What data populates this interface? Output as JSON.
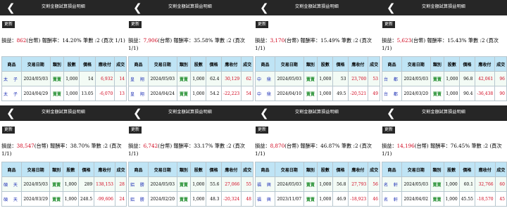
{
  "header": {
    "title": "交割金額試算損益明細",
    "back_icon": "chevron-left-icon",
    "update_label": "更新"
  },
  "table_headers": [
    "商品",
    "交易日期",
    "類別",
    "股數",
    "價格",
    "應收付",
    "成交"
  ],
  "colors": {
    "header_bg": "#262626",
    "th_bg": "#bfe4f5",
    "profit": "#d0021b",
    "type_text": "#1e8c2b",
    "name_text": "#1c2fb5"
  },
  "panels": [
    {
      "profit_prefix": "損益：",
      "profit_value": "862",
      "summary_suffix": "(台幣) 報酬率：14.20% 筆數 :2 (頁次 1/1)",
      "rows": [
        {
          "name": "太 子",
          "date": "2024/05/03",
          "type": "賣賣",
          "shares": "1,000",
          "price": "14",
          "amount": "6,932",
          "extra": "14"
        },
        {
          "name": "太 子",
          "date": "2024/04/29",
          "type": "賣賣",
          "shares": "1,000",
          "price": "13.05",
          "amount": "-6,070",
          "extra": "13"
        }
      ]
    },
    {
      "profit_prefix": "損益：",
      "profit_value": "7,906",
      "summary_suffix": "(台幣) 報酬率：35.58% 筆數 :2 (頁次 1/1)",
      "rows": [
        {
          "name": "皇 翔",
          "date": "2024/05/03",
          "type": "賣賣",
          "shares": "1,000",
          "price": "62.4",
          "amount": "30,129",
          "extra": "62"
        },
        {
          "name": "皇 翔",
          "date": "2024/04/24",
          "type": "賣賣",
          "shares": "1,000",
          "price": "54.2",
          "amount": "-22,223",
          "extra": "54"
        }
      ]
    },
    {
      "profit_prefix": "損益：",
      "profit_value": "3,170",
      "summary_suffix": "(台幣) 報酬率：15.49% 筆數 :2 (頁次 1/1)",
      "rows": [
        {
          "name": "中 鼎",
          "date": "2024/05/03",
          "type": "賣賣",
          "shares": "1,000",
          "price": "53",
          "amount": "23,700",
          "extra": "53"
        },
        {
          "name": "中 鼎",
          "date": "2024/04/10",
          "type": "賣賣",
          "shares": "1,000",
          "price": "49.5",
          "amount": "-20,521",
          "extra": "49"
        }
      ]
    },
    {
      "profit_prefix": "損益：",
      "profit_value": "5,623",
      "summary_suffix": "(台幣) 報酬率：15.43% 筆數 :2 (頁次 1/1)",
      "rows": [
        {
          "name": "台 都",
          "date": "2024/05/03",
          "type": "賣賣",
          "shares": "1,000",
          "price": "96.8",
          "amount": "42,061",
          "extra": "96"
        },
        {
          "name": "台 都",
          "date": "2024/03/20",
          "type": "賣賣",
          "shares": "1,000",
          "price": "90.4",
          "amount": "-36,438",
          "extra": "90"
        }
      ]
    },
    {
      "profit_prefix": "損益：",
      "profit_value": "38,547",
      "summary_suffix": "(台幣) 報酬率：38.70% 筆數 :2 (頁次 1/1)",
      "rows": [
        {
          "name": "碩 天",
          "date": "2024/05/03",
          "type": "賣賣",
          "shares": "1,000",
          "price": "289",
          "amount": "138,153",
          "extra": "28"
        },
        {
          "name": "碩 天",
          "date": "2024/03/29",
          "type": "賣賣",
          "shares": "1,000",
          "price": "248.5",
          "amount": "-99,606",
          "extra": "24"
        }
      ]
    },
    {
      "profit_prefix": "損益：",
      "profit_value": "6,742",
      "summary_suffix": "(台幣) 報酬率：33.17% 筆數 :2 (頁次 1/1)",
      "rows": [
        {
          "name": "鋁 勝",
          "date": "2024/05/03",
          "type": "賣賣",
          "shares": "1,000",
          "price": "55.6",
          "amount": "27,066",
          "extra": "55"
        },
        {
          "name": "鋁 勝",
          "date": "2024/02/20",
          "type": "賣賣",
          "shares": "1,000",
          "price": "48.3",
          "amount": "-20,324",
          "extra": "48"
        }
      ]
    },
    {
      "profit_prefix": "損益：",
      "profit_value": "8,870",
      "summary_suffix": "(台幣) 報酬率：46.87% 筆數 :2 (頁次 1/1)",
      "rows": [
        {
          "name": "福 興",
          "date": "2024/05/03",
          "type": "賣賣",
          "shares": "1,000",
          "price": "56.8",
          "amount": "27,793",
          "extra": "56"
        },
        {
          "name": "福 興",
          "date": "2023/11/07",
          "type": "賣賣",
          "shares": "1,000",
          "price": "46.9",
          "amount": "-18,923",
          "extra": "46"
        }
      ]
    },
    {
      "profit_prefix": "損益：",
      "profit_value": "14,196",
      "summary_suffix": "(台幣) 報酬率：76.45% 筆數 :2 (頁次 1/1)",
      "rows": [
        {
          "name": "名 軒",
          "date": "2024/05/03",
          "type": "賣賣",
          "shares": "1,000",
          "price": "60.1",
          "amount": "32,766",
          "extra": "60"
        },
        {
          "name": "名 軒",
          "date": "2024/04/02",
          "type": "賣賣",
          "shares": "1,000",
          "price": "45.55",
          "amount": "-18,570",
          "extra": "45"
        }
      ]
    }
  ]
}
